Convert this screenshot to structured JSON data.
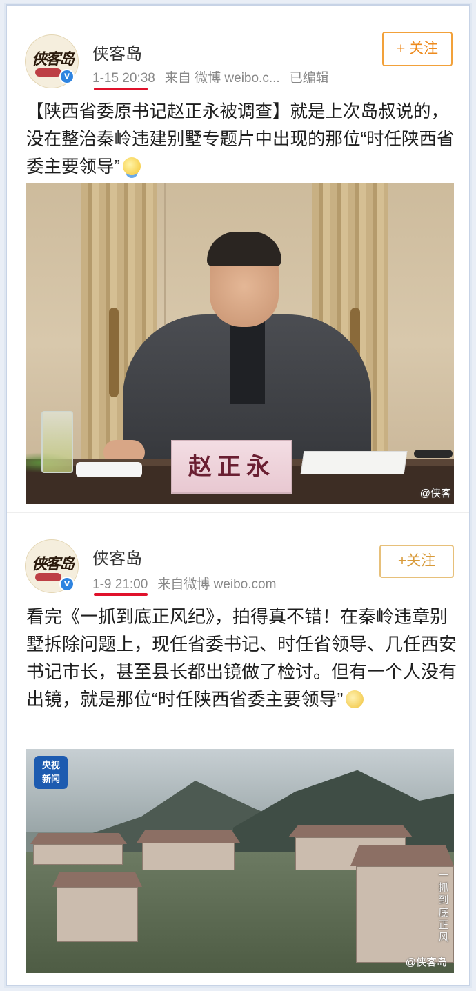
{
  "posts": [
    {
      "username": "侠客岛",
      "avatar_text": "侠客岛",
      "time": "1-15 20:38",
      "source": "来自 微博 weibo.c...",
      "edited": "已编辑",
      "follow_label": "+ 关注",
      "text": "【陕西省委原书记赵正永被调查】就是上次岛叔说的，没在整治秦岭违建别墅专题片中出现的那位“时任陕西省委主要领导”",
      "emoji": "hug-emoji",
      "image": {
        "nameplate": "赵正永",
        "watermark": "@侠客"
      }
    },
    {
      "username": "侠客岛",
      "avatar_text": "侠客岛",
      "time": "1-9 21:00",
      "source": "来自微博 weibo.com",
      "follow_label": "+关注",
      "text": "看完《一抓到底正风纪》，拍得真不错！在秦岭违章别墅拆除问题上，现任省委书记、时任省领导、几任西安书记市长，甚至县长都出镜做了检讨。但有一个人没有出镜，就是那位“时任陕西省委主要领导”",
      "emoji": "smirk-emoji",
      "image": {
        "tv_logo_line1": "央视",
        "tv_logo_line2": "新闻",
        "side_caption": "一抓到底正风",
        "watermark": "@侠客岛"
      }
    }
  ],
  "colors": {
    "underline": "#e0112b",
    "follow": "#ed8a1d",
    "verified": "#2f84e0"
  }
}
